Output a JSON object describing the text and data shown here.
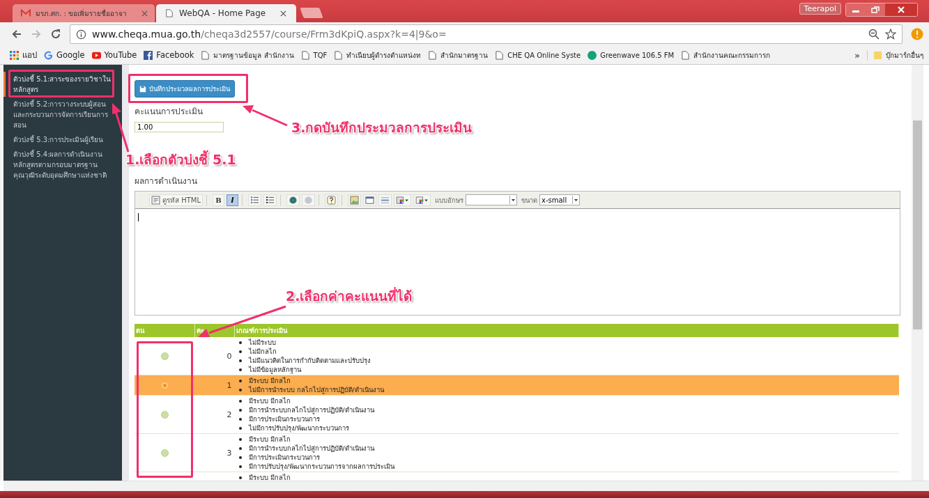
{
  "browser": {
    "tabs": [
      {
        "title": "มรภ.ศก. : ขอเพิ่มรายชื่ออาจา",
        "selected": false
      },
      {
        "title": "WebQA - Home Page",
        "selected": true
      }
    ],
    "profile": "Teerapol",
    "url": {
      "host": "www.cheqa.mua.go.th",
      "path": "/cheqa3d2557/course/Frm3dKpiQ.aspx?k=4|9&o="
    },
    "bookmarks": [
      {
        "kind": "apps",
        "label": "แอป"
      },
      {
        "kind": "google",
        "label": "Google"
      },
      {
        "kind": "youtube",
        "label": "YouTube"
      },
      {
        "kind": "facebook",
        "label": "Facebook"
      },
      {
        "kind": "page",
        "label": "มาตรฐานข้อมูล สำนักงาน"
      },
      {
        "kind": "page",
        "label": "TQF"
      },
      {
        "kind": "page",
        "label": "ทำเนียบผู้ดำรงตำแหน่งท"
      },
      {
        "kind": "page",
        "label": "สำนักมาตรฐาน"
      },
      {
        "kind": "page",
        "label": "CHE QA Online Syste"
      },
      {
        "kind": "radio",
        "label": "Greenwave 106.5 FM"
      },
      {
        "kind": "page",
        "label": "สำนักงานคณะกรรมการก"
      }
    ],
    "more": "»",
    "other_bookmarks": "บุ๊กมาร์กอื่นๆ"
  },
  "sidebar": {
    "items": [
      {
        "label": "ตัวบ่งชี้ 5.1:สาระของรายวิชาในหลักสูตร",
        "selected": true
      },
      {
        "label": "ตัวบ่งชี้ 5.2:การวางระบบผู้สอนและกระบวนการจัดการเรียนการสอน",
        "selected": false
      },
      {
        "label": "ตัวบ่งชี้ 5.3:การประเมินผู้เรียน",
        "selected": false
      },
      {
        "label": "ตัวบ่งชี้ 5.4:ผลการดำเนินงานหลักสูตรตามกรอบมาตรฐานคุณวุฒิระดับอุดมศึกษาแห่งชาติ",
        "selected": false
      }
    ]
  },
  "form": {
    "save_button": "บันทึกประมวลผลการประเมิน",
    "score_label": "คะแนนการประเมิน",
    "score_value": "1.00",
    "result_label": "ผลการดำเนินงาน",
    "toolbar": [
      {
        "kind": "html",
        "label": "ดูรหัส HTML",
        "selected": false
      },
      {
        "kind": "bold",
        "label": "B",
        "selected": false
      },
      {
        "kind": "italic",
        "label": "I",
        "selected": true
      },
      {
        "kind": "olist",
        "selected": false
      },
      {
        "kind": "ulist",
        "selected": false
      },
      {
        "kind": "link",
        "selected": false
      },
      {
        "kind": "unlink",
        "selected": false
      },
      {
        "kind": "help",
        "selected": false
      },
      {
        "kind": "image",
        "selected": false
      },
      {
        "kind": "table",
        "selected": false
      },
      {
        "kind": "hr",
        "selected": false
      },
      {
        "kind": "textcolor",
        "selected": false
      },
      {
        "kind": "bgcolor",
        "selected": false
      }
    ],
    "font_label": "แบบอักษร",
    "size_label": "ขนาด",
    "size_value": "x-small"
  },
  "table": {
    "columns": [
      "ตน",
      "คะ",
      "เกณฑ์การประเมิน"
    ],
    "rows": [
      {
        "score": "0",
        "selected": false,
        "criteria": [
          "ไม่มีระบบ",
          "ไม่มีกลไก",
          "ไม่มีแนวคิดในการกำกับติดตามและปรับปรุง",
          "ไม่มีข้อมูลหลักฐาน"
        ]
      },
      {
        "score": "1",
        "selected": true,
        "criteria": [
          "มีระบบ มีกลไก",
          "ไม่มีการนำระบบ กลไกไปสู่การปฏิบัติ/ดำเนินงาน"
        ]
      },
      {
        "score": "2",
        "selected": false,
        "criteria": [
          "มีระบบ มีกลไก",
          "มีการนำระบบกลไกไปสู่การปฏิบัติ/ดำเนินงาน",
          "มีการประเมินกระบวนการ",
          "ไม่มีการปรับปรุง/พัฒนากระบวนการ"
        ]
      },
      {
        "score": "3",
        "selected": false,
        "criteria": [
          "มีระบบ มีกลไก",
          "มีการนำระบบกลไกไปสู่การปฏิบัติ/ดำเนินงาน",
          "มีการประเมินกระบวนการ",
          "มีการปรับปรุง/พัฒนากระบวนการจากผลการประเมิน"
        ]
      },
      {
        "score": "",
        "selected": false,
        "criteria": [
          "มีระบบ มีกลไก"
        ]
      }
    ]
  },
  "annotations": [
    "3.กดบันทึกประมวลการประเมิน",
    "1.เลือกตัวบ่งชี้ 5.1",
    "2.เลือกค่าคะแนนที่ได้"
  ]
}
